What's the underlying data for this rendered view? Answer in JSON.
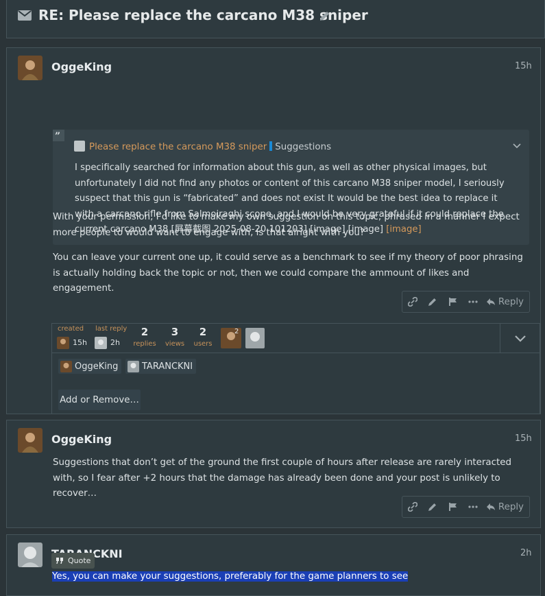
{
  "topic": {
    "title": "RE: Please replace the carcano M38 sniper"
  },
  "post1": {
    "username": "OggeKing",
    "time": "15h",
    "quote": {
      "link_title": "Please replace the carcano M38 sniper",
      "category": "Suggestions",
      "text": "I specifically searched for information about this gun, as well as other physical images, but unfortunately I did not find any photos or content of this carcano M38 sniper model, I seriously suspect that this gun is “fabricated” and does not exist It would be the best idea to replace it with a carcano rifle from Salmoiraghi scope, and I would be very grateful if it could replace the current carcano M38 [屏幕截图 2025-08-20 101203] [image] [image] ",
      "image_link": "[image]"
    },
    "para1": "With your permission, I’d like to make my own suggestion on this topic, phrased in a manner I expect more people to would want to engage with, is that alright with you?",
    "para2": "You can leave your current one up, it could serve as a benchmark to see if my theory of poor phrasing is actually holding back the topic or not, then we could compare the ammount of likes and engagement.",
    "reply_label": "Reply"
  },
  "topic_map": {
    "created_label": "created",
    "created_time": "15h",
    "last_reply_label": "last reply",
    "last_reply_time": "2h",
    "replies": {
      "count": "2",
      "label": "replies"
    },
    "views": {
      "count": "3",
      "label": "views"
    },
    "users": {
      "count": "2",
      "label": "users"
    },
    "avatar_badge": "2",
    "participants": [
      "OggeKing",
      "TARANCKNI"
    ],
    "add_button": "Add or Remove…"
  },
  "post2": {
    "username": "OggeKing",
    "time": "15h",
    "text": "Suggestions that don’t get of the ground the first couple of hours after release are rarely interacted with, so I fear after +2 hours that the damage has already been done and your post is unlikely to recover…",
    "reply_label": "Reply"
  },
  "post3": {
    "username": "TARANCKNI",
    "time": "2h",
    "text": "Yes, you can make your suggestions, preferably for the game planners to see",
    "quote_button": "Quote"
  },
  "icons": [
    "envelope-icon",
    "pencil-icon",
    "quote-icon",
    "chevron-down-icon",
    "link-icon",
    "flag-icon",
    "ellipsis-icon",
    "reply-icon"
  ],
  "colors": {
    "accent": "#d69a5b",
    "category": "#1a8ad6",
    "selection": "#1a3fb5"
  }
}
